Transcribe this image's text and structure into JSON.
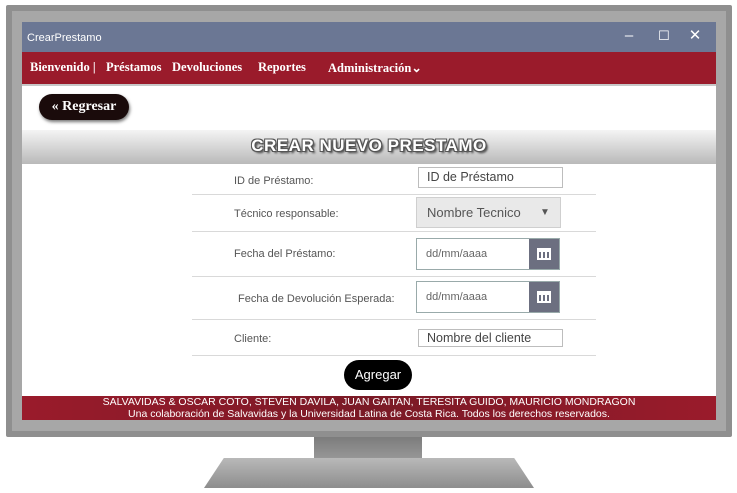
{
  "window": {
    "title": "CrearPrestamo",
    "controls": {
      "minimize": "–",
      "maximize": "☐",
      "close": "✕"
    }
  },
  "menu": {
    "items": [
      {
        "label": "Bienvenido |"
      },
      {
        "label": "Préstamos"
      },
      {
        "label": "Devoluciones"
      },
      {
        "label": "Reportes"
      },
      {
        "label": "Administración"
      }
    ],
    "admin_caret": "⌄"
  },
  "back_button": "« Regresar",
  "page_title": "CREAR NUEVO PRESTAMO",
  "form": {
    "id_label": "ID de Préstamo:",
    "id_value": "ID de Préstamo",
    "tecnico_label": "Técnico responsable:",
    "tecnico_value": "Nombre Tecnico",
    "fecha_prestamo_label": "Fecha del Préstamo:",
    "fecha_prestamo_placeholder": "dd/mm/aaaa",
    "fecha_devolucion_label": "Fecha de Devolución Esperada:",
    "fecha_devolucion_placeholder": "dd/mm/aaaa",
    "cliente_label": "Cliente:",
    "cliente_value": "Nombre del cliente"
  },
  "submit_button": "Agregar",
  "footer": {
    "line1": "SALVAVIDAS & OSCAR COTO, STEVEN DAVILA, JUAN GAITAN, TERESITA GUIDO, MAURICIO MONDRAGON",
    "line2": "Una colaboración de Salvavidas y la Universidad Latina de Costa Rica. Todos los derechos reservados."
  },
  "colors": {
    "menubar": "#9a1b2b",
    "titlebar": "#6b7794",
    "button": "#000000"
  },
  "icons": {
    "calendar": "calendar-icon",
    "dropdown": "chevron-down-icon"
  }
}
